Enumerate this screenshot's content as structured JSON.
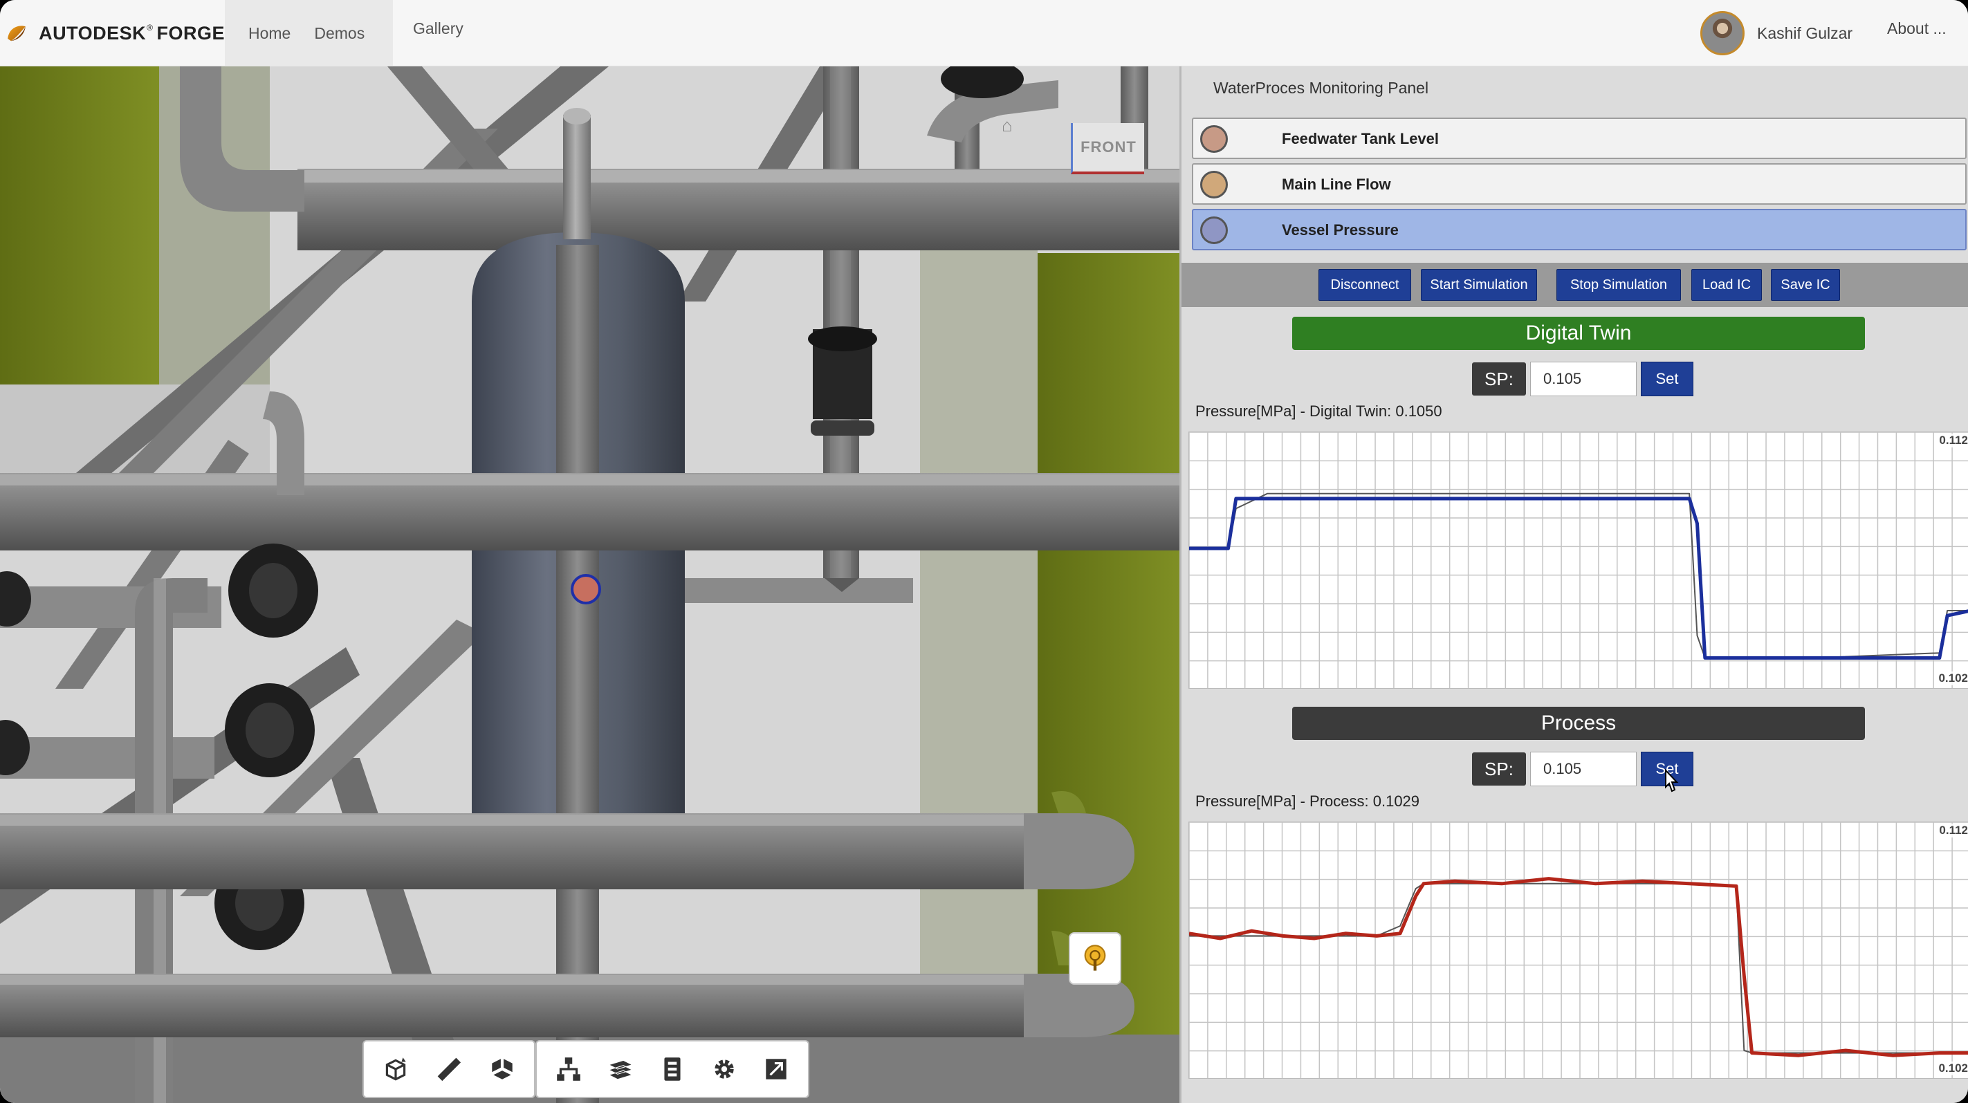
{
  "navbar": {
    "brand": "AUTODESK",
    "brand_reg": "®",
    "brand_product": "FORGE",
    "links": [
      "Home",
      "Demos",
      "Gallery"
    ],
    "user_name": "Kashif Gulzar",
    "about": "About ..."
  },
  "viewer": {
    "viewcube_label": "FRONT",
    "accent_colors": {
      "wall_olive": "#6f7e1c",
      "vessel": "#5f6673",
      "marker": "#c76f5f"
    },
    "toolbar_icons": [
      "orbit-icon",
      "measure-icon",
      "explode-icon",
      "model-browser-icon",
      "layers-icon",
      "properties-icon",
      "settings-icon",
      "fullscreen-icon"
    ]
  },
  "panel": {
    "title": "WaterProces Monitoring Panel",
    "sensors": [
      {
        "label": "Feedwater Tank Level",
        "color": "#c79a86",
        "selected": false
      },
      {
        "label": "Main Line Flow",
        "color": "#d0a87a",
        "selected": false
      },
      {
        "label": "Vessel Pressure",
        "color": "#8f96c4",
        "selected": true
      }
    ],
    "buttons": [
      "Disconnect",
      "Start Simulation",
      "Stop Simulation",
      "Load IC",
      "Save IC"
    ],
    "digital_twin": {
      "header": "Digital Twin",
      "sp_label": "SP:",
      "sp_value": "0.105",
      "set_label": "Set",
      "chart_title": "Pressure[MPa] - Digital Twin: 0.1050"
    },
    "process": {
      "header": "Process",
      "sp_label": "SP:",
      "sp_value": "0.105",
      "set_label": "Set",
      "chart_title": "Pressure[MPa] - Process: 0.1029"
    }
  },
  "chart_data": [
    {
      "type": "line",
      "title": "Pressure[MPa] - Digital Twin: 0.1050",
      "ylim": [
        0.102,
        0.112
      ],
      "ytick_labels": [
        "0.112",
        "0.102"
      ],
      "grid": true,
      "x": [
        0,
        5,
        6,
        10,
        64,
        65,
        66,
        80,
        96,
        97,
        100
      ],
      "series": [
        {
          "color": "#1b2f9c",
          "values": [
            0.1075,
            0.1075,
            0.1095,
            0.1095,
            0.1095,
            0.1085,
            0.1031,
            0.1031,
            0.1031,
            0.1048,
            0.105
          ]
        },
        {
          "color": "#555555",
          "values": [
            0.1075,
            0.1075,
            0.1091,
            0.1097,
            0.1097,
            0.104,
            0.1031,
            0.1031,
            0.1033,
            0.105,
            0.105
          ]
        }
      ]
    },
    {
      "type": "line",
      "title": "Pressure[MPa] - Process: 0.1029",
      "ylim": [
        0.102,
        0.112
      ],
      "ytick_labels": [
        "0.112",
        "0.102"
      ],
      "grid": true,
      "x": [
        0,
        4,
        8,
        12,
        16,
        20,
        24,
        27,
        29,
        30,
        34,
        40,
        46,
        52,
        58,
        64,
        70,
        71,
        72,
        78,
        84,
        90,
        96,
        100
      ],
      "series": [
        {
          "color": "#b4261a",
          "values": [
            0.1077,
            0.1075,
            0.1078,
            0.1076,
            0.1075,
            0.1077,
            0.1076,
            0.1077,
            0.1092,
            0.1097,
            0.1098,
            0.1097,
            0.1099,
            0.1097,
            0.1098,
            0.1097,
            0.1096,
            0.106,
            0.1029,
            0.1028,
            0.103,
            0.1028,
            0.1029,
            0.1029
          ]
        },
        {
          "color": "#555555",
          "values": [
            0.1076,
            0.1076,
            0.1076,
            0.1076,
            0.1076,
            0.1076,
            0.1076,
            0.108,
            0.1095,
            0.1097,
            0.1097,
            0.1097,
            0.1097,
            0.1097,
            0.1097,
            0.1097,
            0.1096,
            0.103,
            0.1029,
            0.1029,
            0.1029,
            0.1029,
            0.1029,
            0.1029
          ]
        }
      ]
    }
  ]
}
